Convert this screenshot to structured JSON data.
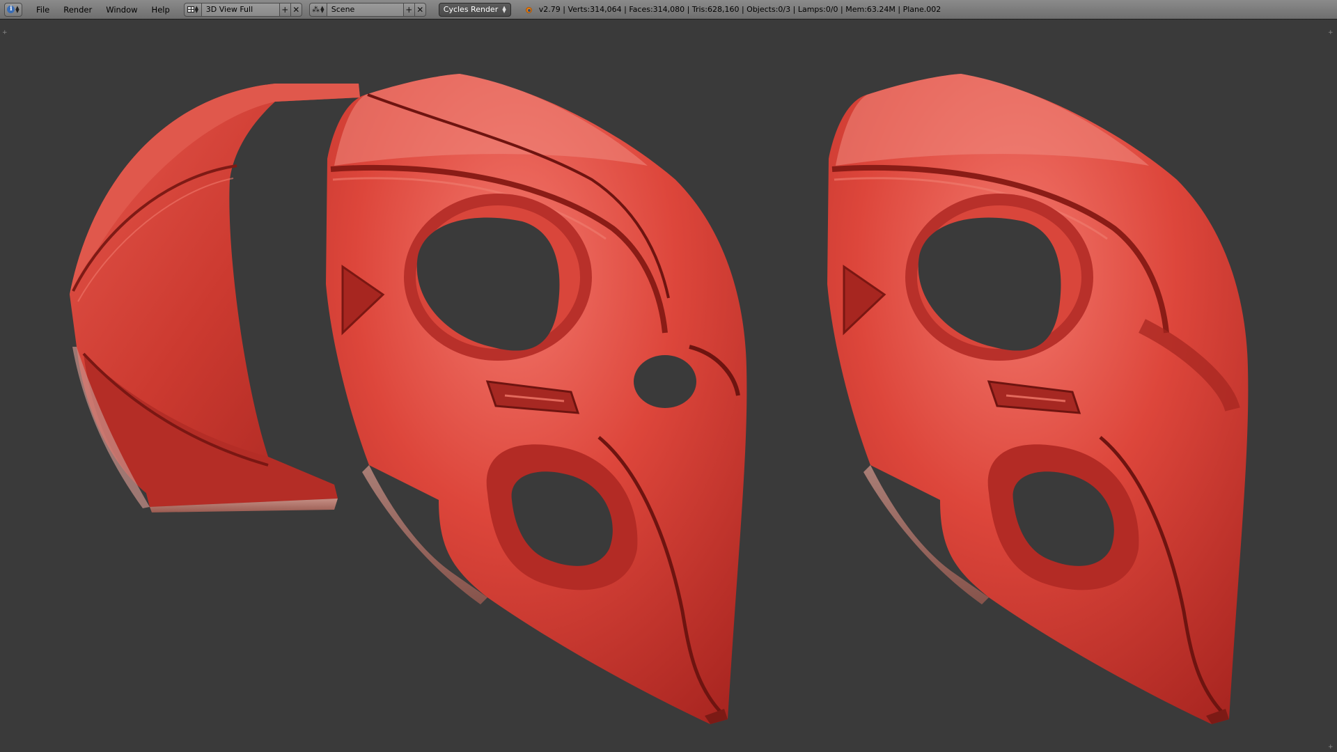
{
  "header": {
    "editor_type_icon": "info-icon",
    "menus": [
      "File",
      "Render",
      "Window",
      "Help"
    ],
    "screen_layout": {
      "icon": "screen-layout-icon",
      "value": "3D View Full"
    },
    "scene": {
      "icon": "scene-icon",
      "value": "Scene"
    },
    "render_engine": "Cycles Render",
    "logo": "blender-logo-icon",
    "stats": "v2.79 | Verts:314,064 | Faces:314,080 | Tris:628,160 | Objects:0/3 | Lamps:0/0 | Mem:63.24M | Plane.002"
  },
  "viewport": {
    "background_color": "#3a3a3a",
    "objects": [
      {
        "kind": "helmet-back-piece",
        "color": "#d43d33"
      },
      {
        "kind": "mask-front-seamed",
        "color": "#d43d33"
      },
      {
        "kind": "mask-front-smooth",
        "color": "#d43d33"
      }
    ]
  }
}
